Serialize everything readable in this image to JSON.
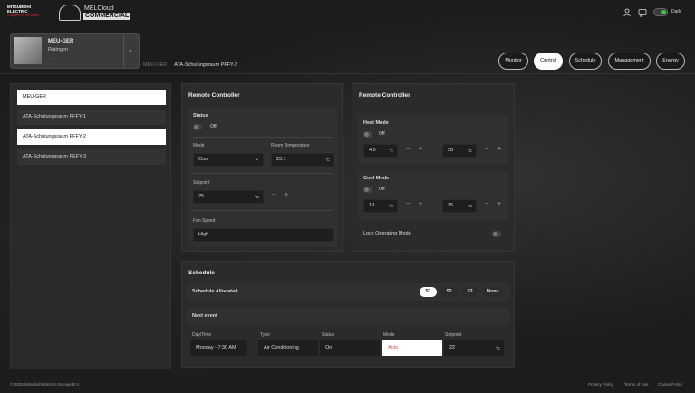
{
  "header": {
    "brand_lines": [
      "MITSUBISHI",
      "ELECTRIC"
    ],
    "brand_tagline": "Changes for the Better",
    "app_name_line1": "MELCloud",
    "app_name_line2": "COMMERCIAL",
    "theme_label": "Dark"
  },
  "location": {
    "name": "MEU-GER",
    "city": "Ratingen",
    "sub": "..."
  },
  "breadcrumb": {
    "parent": "MEU-GER",
    "current": "ATA-Schulungsraum PFFY-2"
  },
  "nav": [
    "Monitor",
    "Control",
    "Schedule",
    "Management",
    "Energy"
  ],
  "devices": [
    "MEU-GER",
    "ATA-Schulungsraum PFFY-1",
    "ATA-Schulungsraum PFFY-2",
    "ATA-Schulungsraum PEFY-3"
  ],
  "remote1": {
    "title": "Remote Controller",
    "status_label": "Status",
    "status_value": "Off",
    "mode_label": "Mode",
    "mode_value": "Cool",
    "room_temp_label": "Room Temperature",
    "room_temp_value": "23.1",
    "setpoint_label": "Setpoint",
    "setpoint_value": "25",
    "fan_label": "Fan Speed",
    "fan_value": "High",
    "unit": "°C"
  },
  "remote2": {
    "title": "Remote Controller",
    "heat_label": "Heat Mode",
    "heat_state": "Off",
    "heat_min": "4.5",
    "heat_max": "28",
    "cool_label": "Cool Mode",
    "cool_state": "Off",
    "cool_min": "19",
    "cool_max": "35",
    "lock_label": "Lock Operating Mode",
    "unit": "°C"
  },
  "schedule": {
    "title": "Schedule",
    "allocated_label": "Schedule Allocated",
    "chips": [
      "S1",
      "S2",
      "S3",
      "None"
    ],
    "next_event_label": "Next event",
    "cols": [
      "Day/Time",
      "Type",
      "Status",
      "Mode",
      "Setpoint"
    ],
    "values": [
      "Monday - 7:30 AM",
      "Air Conditioning",
      "On",
      "Auto",
      "22"
    ],
    "unit": "°C"
  },
  "footer": {
    "copyright": "© 2025 Mitsubishi Electric Europe B.V.",
    "links": [
      "Privacy Policy",
      "Terms of Use",
      "Cookie Policy"
    ]
  }
}
